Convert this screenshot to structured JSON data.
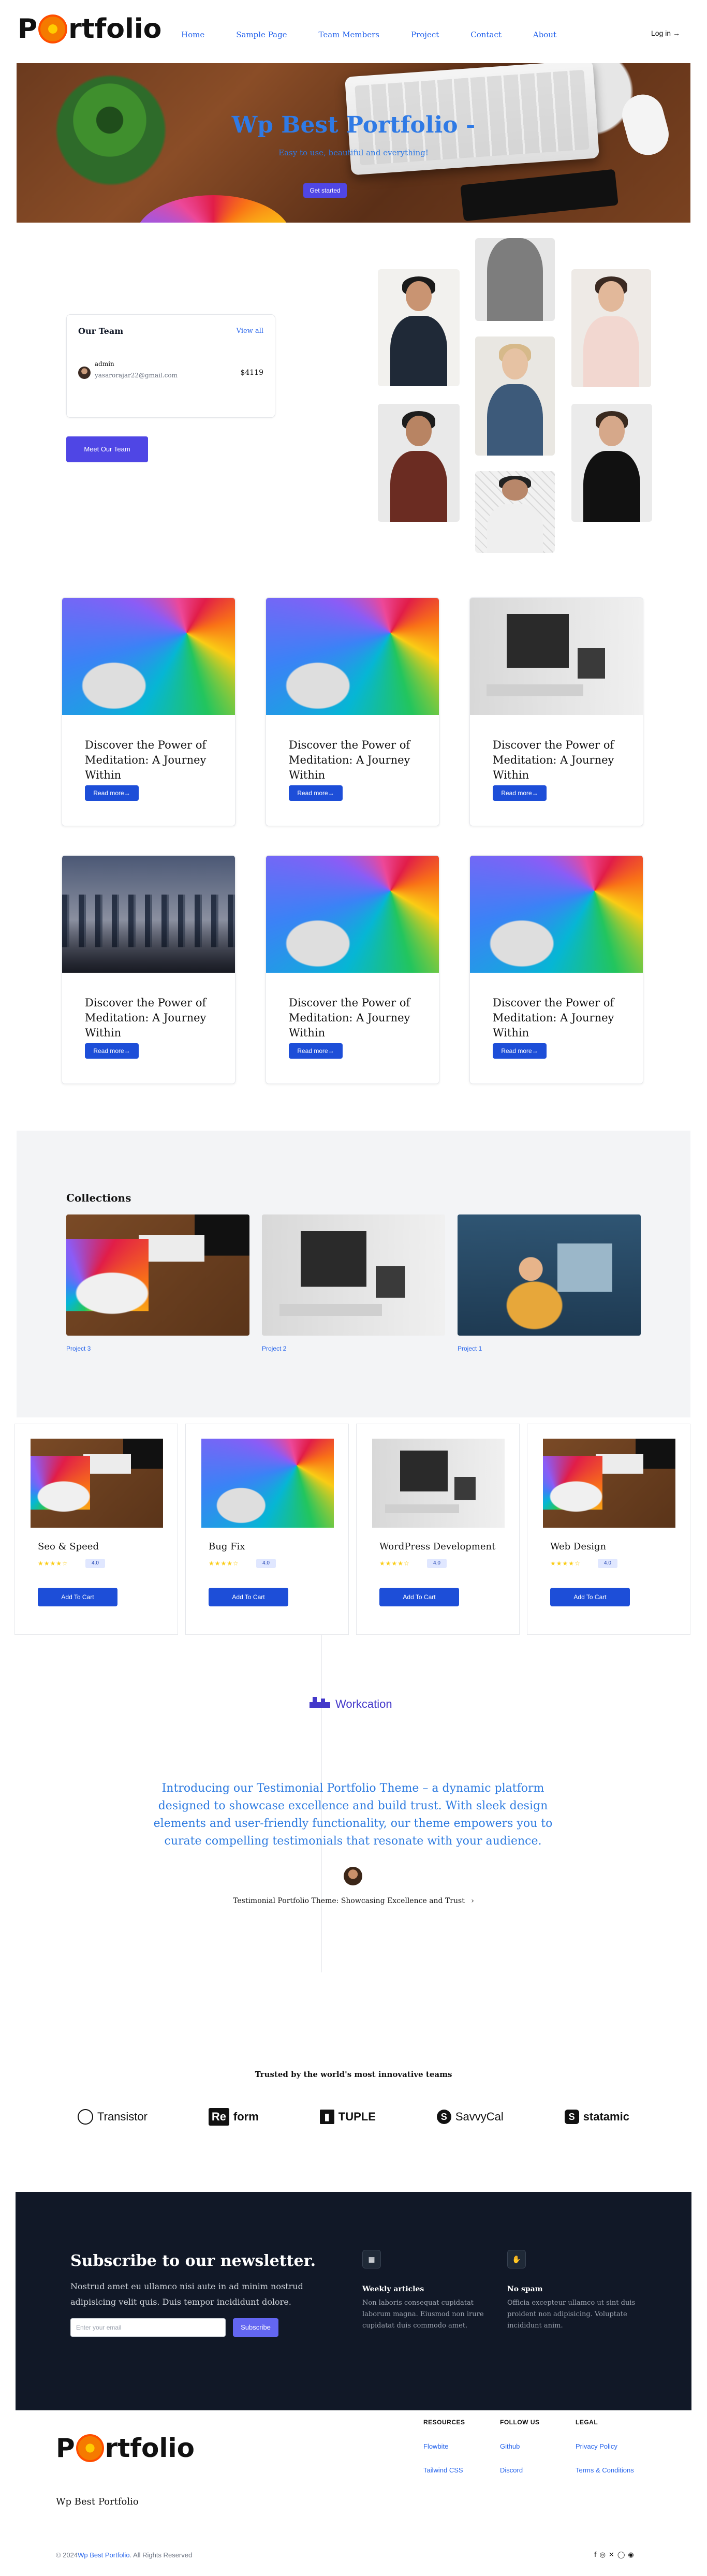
{
  "header": {
    "logo_text_before": "P",
    "logo_text_after": "rtfolio",
    "nav": [
      "Home",
      "Sample Page",
      "Team Members",
      "Project",
      "Contact",
      "About"
    ],
    "login": "Log in →"
  },
  "hero": {
    "title": "Wp Best Portfolio -",
    "subtitle": "Easy to use, beautiful and everything!",
    "button": "Get started"
  },
  "team": {
    "title": "Our Team",
    "view_all": "View all",
    "member_name": "admin",
    "member_email": "yasarorajar22@gmail.com",
    "amount": "$4119",
    "button": "Meet Our Team"
  },
  "posts": [
    {
      "title": "Discover the Power of Meditation: A Journey Within",
      "button": "Read more→"
    },
    {
      "title": "Discover the Power of Meditation: A Journey Within",
      "button": "Read more→"
    },
    {
      "title": "Discover the Power of Meditation: A Journey Within",
      "button": "Read more→"
    },
    {
      "title": "Discover the Power of Meditation: A Journey Within",
      "button": "Read more→"
    },
    {
      "title": "Discover the Power of Meditation: A Journey Within",
      "button": "Read more→"
    },
    {
      "title": "Discover the Power of Meditation: A Journey Within",
      "button": "Read more→"
    }
  ],
  "collections": {
    "title": "Collections",
    "items": [
      "Project 3",
      "Project 2",
      "Project 1"
    ]
  },
  "products": [
    {
      "name": "Seo & Speed",
      "stars": "★★★★☆",
      "rating": "4.0",
      "button": "Add To Cart"
    },
    {
      "name": "Bug Fix",
      "stars": "★★★★☆",
      "rating": "4.0",
      "button": "Add To Cart"
    },
    {
      "name": "WordPress Development",
      "stars": "★★★★☆",
      "rating": "4.0",
      "button": "Add To Cart"
    },
    {
      "name": "Web Design",
      "stars": "★★★★☆",
      "rating": "4.0",
      "button": "Add To Cart"
    }
  ],
  "testimonial": {
    "brand": "Workcation",
    "quote": "Introducing our Testimonial Portfolio Theme – a dynamic platform designed to showcase excellence and build trust. With sleek design elements and user-friendly functionality, our theme empowers you to curate compelling testimonials that resonate with your audience.",
    "author": "Testimonial Portfolio Theme: Showcasing Excellence and Trust",
    "arrow": "›"
  },
  "trusted": {
    "title": "Trusted by the world's most innovative teams",
    "logos": [
      "Transistor",
      "Reform",
      "TUPLE",
      "SavvyCal",
      "statamic"
    ],
    "reform_mark": "Re",
    "reform_rest": "form"
  },
  "newsletter": {
    "title": "Subscribe to our newsletter.",
    "text": "Nostrud amet eu ullamco nisi aute in ad minim nostrud adipisicing velit quis. Duis tempor incididunt dolore.",
    "placeholder": "Enter your email",
    "button": "Subscribe",
    "features": [
      {
        "icon": "calendar-icon",
        "glyph": "▦",
        "title": "Weekly articles",
        "text": "Non laboris consequat cupidatat laborum magna. Eiusmod non irure cupidatat duis commodo amet."
      },
      {
        "icon": "hand-icon",
        "glyph": "✋",
        "title": "No spam",
        "text": "Officia excepteur ullamco ut sint duis proident non adipisicing. Voluptate incididunt anim."
      }
    ]
  },
  "footer": {
    "site_name": "Wp Best Portfolio",
    "columns": [
      {
        "heading": "RESOURCES",
        "links": [
          "Flowbite",
          "Tailwind CSS"
        ]
      },
      {
        "heading": "FOLLOW US",
        "links": [
          "Github",
          "Discord"
        ]
      },
      {
        "heading": "LEGAL",
        "links": [
          "Privacy Policy",
          "Terms & Conditions"
        ]
      }
    ],
    "copyright_prefix": "© 2024",
    "copyright_link": "Wp Best Portfolio",
    "copyright_suffix": ". All Rights Reserved",
    "social": [
      "f",
      "◎",
      "✕",
      "◯",
      "◉"
    ]
  },
  "colors": {
    "accent": "#2563eb",
    "primary_button": "#4f46e5",
    "dark_bg": "#111827",
    "hero_text": "#2f7ae5"
  }
}
